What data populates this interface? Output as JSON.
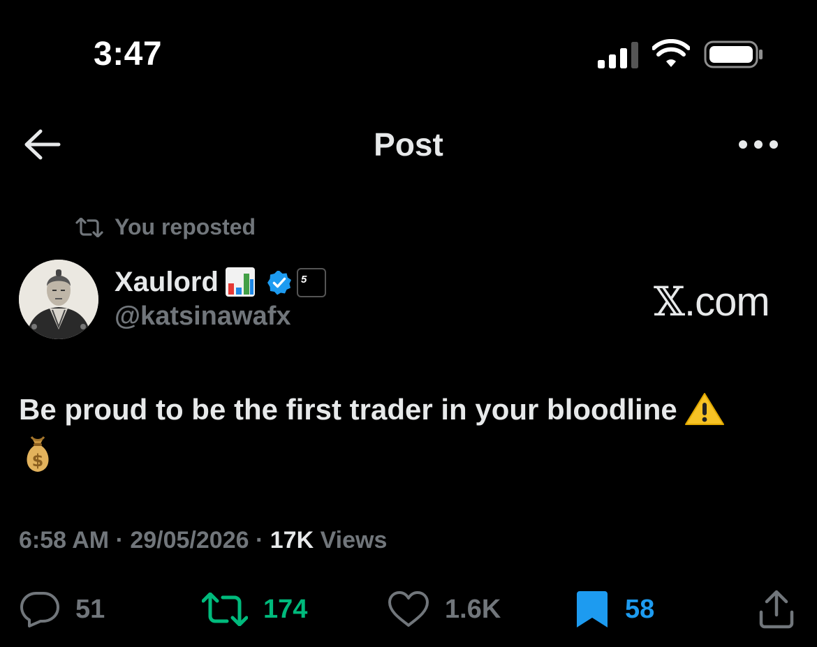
{
  "status_bar": {
    "time": "3:47",
    "signal_icon": "cellular-signal-icon",
    "wifi_icon": "wifi-icon",
    "battery_icon": "battery-icon"
  },
  "nav": {
    "back_icon": "arrow-left-icon",
    "title": "Post",
    "more_icon": "more-horizontal-icon"
  },
  "repost_context": {
    "label": "You reposted",
    "icon": "repost-icon"
  },
  "author": {
    "name": "Xaulord",
    "name_emoji": "bar-chart-emoji",
    "verified": true,
    "affiliate_badge": "5",
    "handle": "@katsinawafx"
  },
  "watermark": "X.com",
  "post": {
    "text": "Be proud to be the first trader in your bloodline",
    "emojis": [
      "warning-emoji",
      "money-bag-emoji"
    ]
  },
  "meta": {
    "time": "6:58 AM",
    "separator": "·",
    "date": "29/05/2026",
    "views_count": "17K",
    "views_label": "Views"
  },
  "actions": {
    "reply_count": "51",
    "repost_count": "174",
    "like_count": "1.6K",
    "bookmark_count": "58"
  },
  "colors": {
    "background": "#000000",
    "text_primary": "#e7e9ea",
    "text_secondary": "#71767b",
    "repost_green": "#00ba7c",
    "accent_blue": "#1d9bf0"
  }
}
